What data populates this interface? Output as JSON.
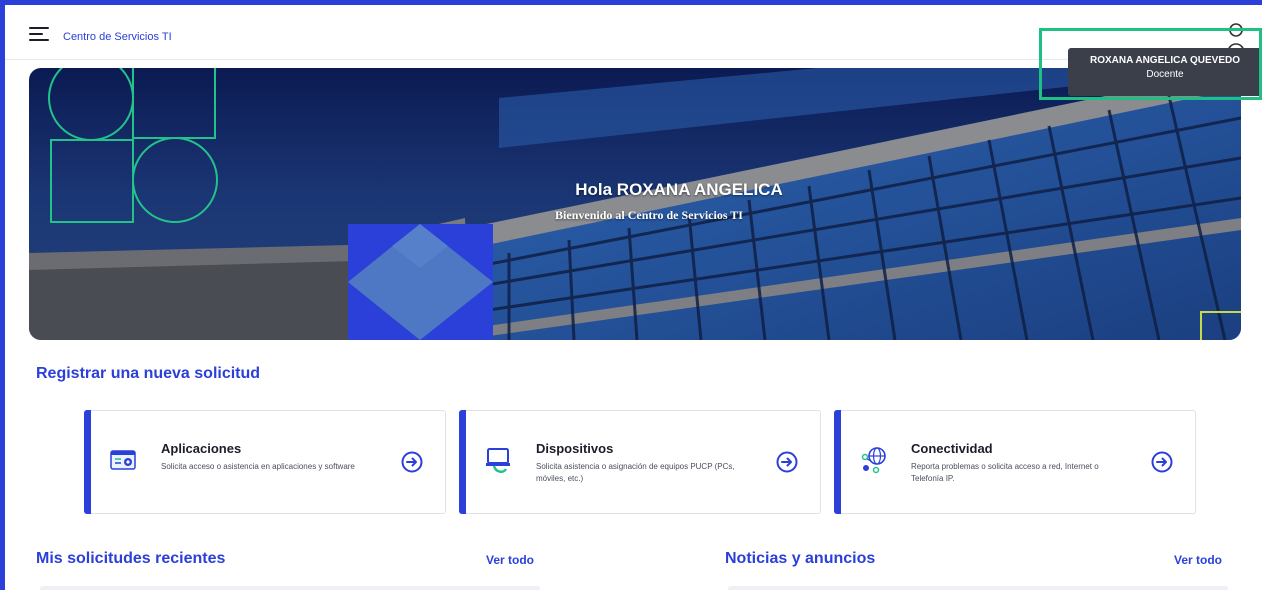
{
  "header": {
    "app_title": "Centro de Servicios TI",
    "user_name": "ROXANA ANGELICA QUEVEDO",
    "user_role": "Docente"
  },
  "hero": {
    "greeting": "Hola ROXANA ANGELICA",
    "subtitle": "Bienvenido al Centro de Servicios TI"
  },
  "request_section": {
    "title": "Registrar una nueva solicitud",
    "cards": [
      {
        "title": "Aplicaciones",
        "description": "Solicita acceso o asistencia en aplicaciones y software",
        "icon": "app-window-icon"
      },
      {
        "title": "Dispositivos",
        "description": "Solicita asistencia o asignación de equipos PUCP (PCs, móviles, etc.)",
        "icon": "laptop-icon"
      },
      {
        "title": "Conectividad",
        "description": "Reporta problemas o solicita acceso a red, Internet o Telefonía IP.",
        "icon": "globe-network-icon"
      }
    ]
  },
  "recent_requests": {
    "title": "Mis solicitudes recientes",
    "see_all": "Ver todo"
  },
  "news": {
    "title": "Noticias y anuncios",
    "see_all": "Ver todo"
  },
  "colors": {
    "primary": "#2b3fd9",
    "highlight": "#1fc084",
    "accent_green": "#23c28a"
  }
}
